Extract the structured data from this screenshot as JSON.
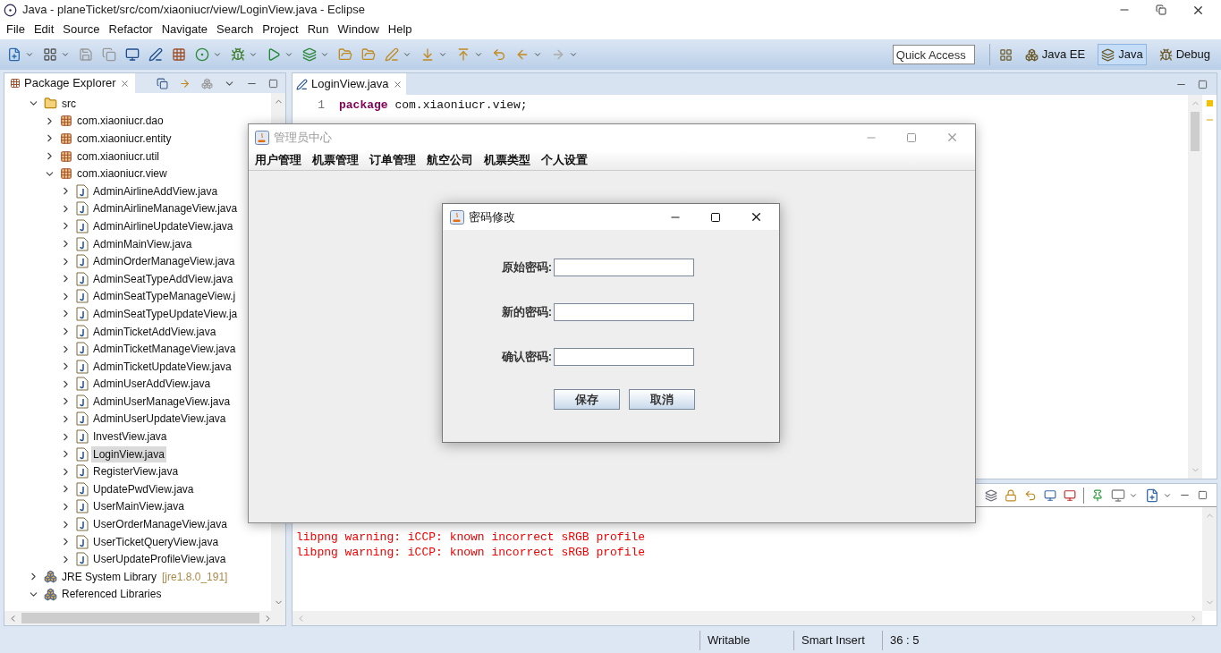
{
  "window": {
    "title": "Java - planeTicket/src/com/xiaoniucr/view/LoginView.java - Eclipse"
  },
  "menu": [
    "File",
    "Edit",
    "Source",
    "Refactor",
    "Navigate",
    "Search",
    "Project",
    "Run",
    "Window",
    "Help"
  ],
  "toolbar": {
    "quick_access": {
      "placeholder": "Quick Access"
    },
    "perspectives": [
      {
        "label": "Java EE",
        "kind": "javaee",
        "selected": false
      },
      {
        "label": "Java",
        "kind": "java",
        "selected": true
      },
      {
        "label": "Debug",
        "kind": "debug",
        "selected": false
      }
    ]
  },
  "package_explorer": {
    "title": "Package Explorer",
    "tree": [
      {
        "label": "src",
        "kind": "folder",
        "expanded": true,
        "selected": false,
        "children": [
          {
            "label": "com.xiaoniucr.dao",
            "kind": "package",
            "expanded": false,
            "selected": false
          },
          {
            "label": "com.xiaoniucr.entity",
            "kind": "package",
            "expanded": false,
            "selected": false
          },
          {
            "label": "com.xiaoniucr.util",
            "kind": "package",
            "expanded": false,
            "selected": false
          },
          {
            "label": "com.xiaoniucr.view",
            "kind": "package",
            "expanded": true,
            "selected": false,
            "children": [
              {
                "label": "AdminAirlineAddView.java",
                "kind": "file",
                "expanded": false,
                "selected": false
              },
              {
                "label": "AdminAirlineManageView.java",
                "kind": "file",
                "expanded": false,
                "selected": false
              },
              {
                "label": "AdminAirlineUpdateView.java",
                "kind": "file",
                "expanded": false,
                "selected": false
              },
              {
                "label": "AdminMainView.java",
                "kind": "file",
                "expanded": false,
                "selected": false
              },
              {
                "label": "AdminOrderManageView.java",
                "kind": "file",
                "expanded": false,
                "selected": false
              },
              {
                "label": "AdminSeatTypeAddView.java",
                "kind": "file",
                "expanded": false,
                "selected": false
              },
              {
                "label": "AdminSeatTypeManageView.j",
                "kind": "file",
                "expanded": false,
                "selected": false
              },
              {
                "label": "AdminSeatTypeUpdateView.ja",
                "kind": "file",
                "expanded": false,
                "selected": false
              },
              {
                "label": "AdminTicketAddView.java",
                "kind": "file",
                "expanded": false,
                "selected": false
              },
              {
                "label": "AdminTicketManageView.java",
                "kind": "file",
                "expanded": false,
                "selected": false
              },
              {
                "label": "AdminTicketUpdateView.java",
                "kind": "file",
                "expanded": false,
                "selected": false
              },
              {
                "label": "AdminUserAddView.java",
                "kind": "file",
                "expanded": false,
                "selected": false
              },
              {
                "label": "AdminUserManageView.java",
                "kind": "file",
                "expanded": false,
                "selected": false
              },
              {
                "label": "AdminUserUpdateView.java",
                "kind": "file",
                "expanded": false,
                "selected": false
              },
              {
                "label": "InvestView.java",
                "kind": "file",
                "expanded": false,
                "selected": false
              },
              {
                "label": "LoginView.java",
                "kind": "file",
                "expanded": false,
                "selected": true
              },
              {
                "label": "RegisterView.java",
                "kind": "file",
                "expanded": false,
                "selected": false
              },
              {
                "label": "UpdatePwdView.java",
                "kind": "file",
                "expanded": false,
                "selected": false
              },
              {
                "label": "UserMainView.java",
                "kind": "file",
                "expanded": false,
                "selected": false
              },
              {
                "label": "UserOrderManageView.java",
                "kind": "file",
                "expanded": false,
                "selected": false
              },
              {
                "label": "UserTicketQueryView.java",
                "kind": "file",
                "expanded": false,
                "selected": false
              },
              {
                "label": "UserUpdateProfileView.java",
                "kind": "file",
                "expanded": false,
                "selected": false
              }
            ]
          }
        ]
      },
      {
        "label": "JRE System Library",
        "suffix": "[jre1.8.0_191]",
        "kind": "library",
        "expanded": false,
        "selected": false
      },
      {
        "label": "Referenced Libraries",
        "kind": "library",
        "expanded": true,
        "selected": false
      }
    ]
  },
  "editor": {
    "tab": "LoginView.java",
    "lines": [
      {
        "number": "1",
        "keyword": "package",
        "code": "com.xiaoniucr.view;"
      }
    ]
  },
  "console": {
    "lines": [
      "libpng warning: iCCP: known incorrect sRGB profile",
      "libpng warning: iCCP: known incorrect sRGB profile"
    ]
  },
  "status_bar": [
    "Writable",
    "Smart Insert",
    "36 : 5"
  ],
  "admin_window": {
    "title": "管理员中心",
    "menu": [
      "用户管理",
      "机票管理",
      "订单管理",
      "航空公司",
      "机票类型",
      "个人设置"
    ]
  },
  "dialog": {
    "title": "密码修改",
    "fields": [
      {
        "label": "原始密码:"
      },
      {
        "label": "新的密码:"
      },
      {
        "label": "确认密码:"
      }
    ],
    "buttons": [
      "保存",
      "取消"
    ]
  }
}
